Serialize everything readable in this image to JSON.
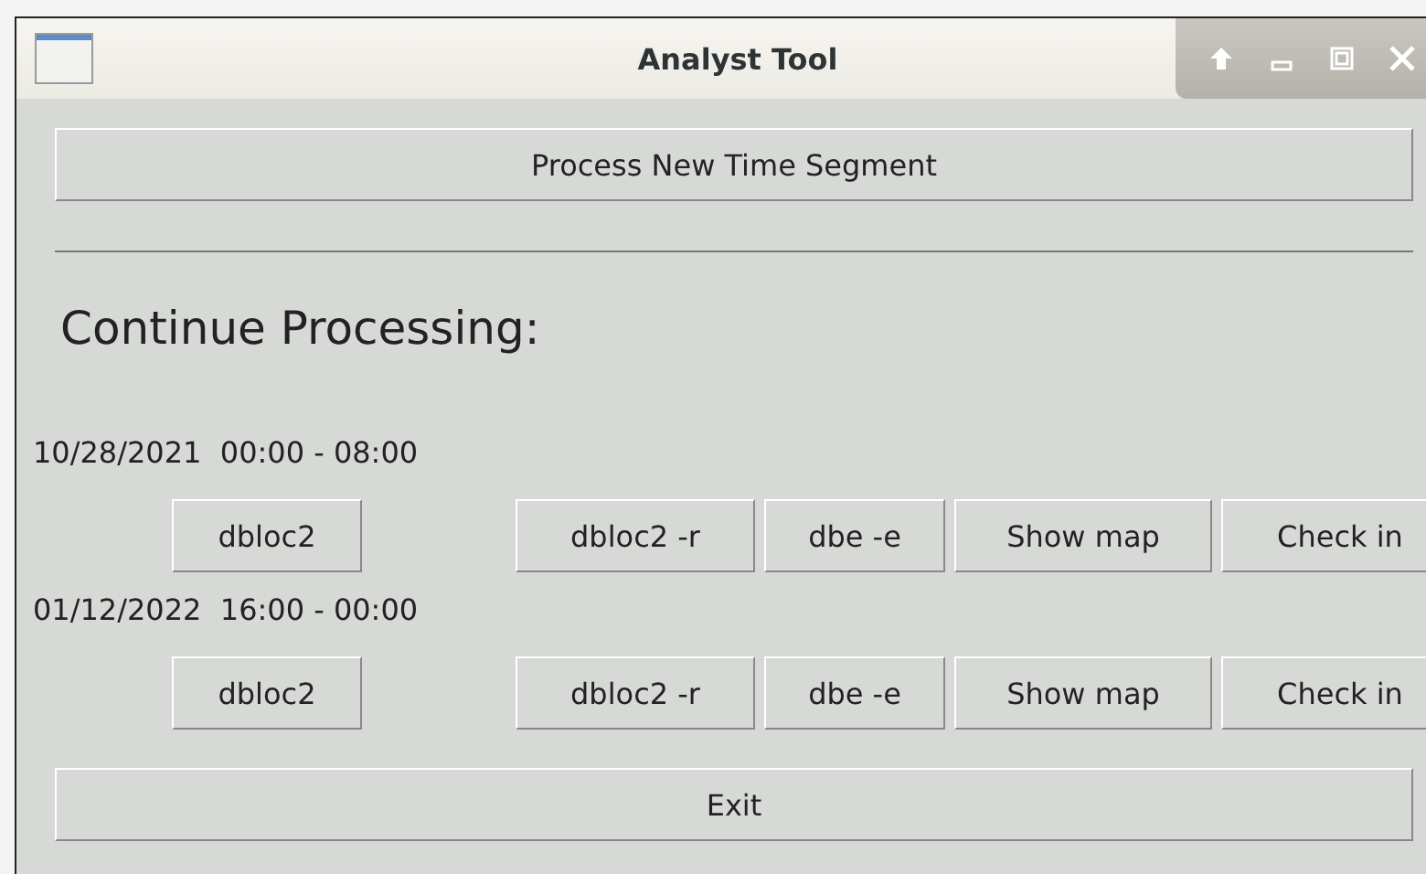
{
  "window": {
    "title": "Analyst Tool"
  },
  "process_button": "Process New Time Segment",
  "section_title": "Continue Processing:",
  "segments": [
    {
      "label": "10/28/2021  00:00 - 08:00",
      "buttons": [
        "dbloc2",
        "dbloc2 -r",
        "dbe -e",
        "Show map",
        "Check in"
      ]
    },
    {
      "label": "01/12/2022  16:00 - 00:00",
      "buttons": [
        "dbloc2",
        "dbloc2 -r",
        "dbe -e",
        "Show map",
        "Check in"
      ]
    }
  ],
  "exit_button": "Exit"
}
